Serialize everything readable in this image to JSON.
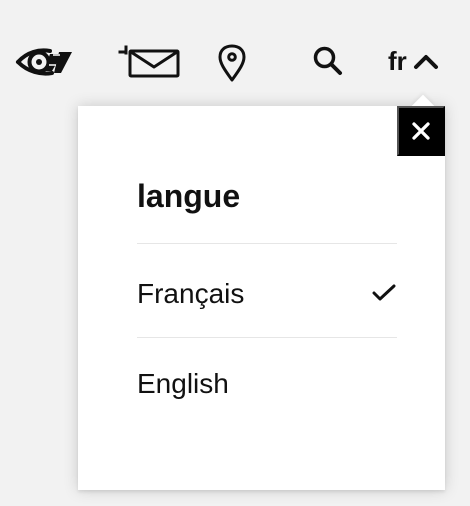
{
  "toolbar": {
    "icons": [
      {
        "name": "eye-icon"
      },
      {
        "name": "mail-icon"
      },
      {
        "name": "location-pin-icon"
      },
      {
        "name": "search-icon"
      }
    ],
    "language_toggle": {
      "current": "fr",
      "expanded": true
    }
  },
  "language_panel": {
    "title": "langue",
    "options": [
      {
        "label": "Français",
        "selected": true
      },
      {
        "label": "English",
        "selected": false
      }
    ],
    "close_icon": "close-icon",
    "colors": {
      "panel": "#ffffff",
      "close_background": "#000000",
      "close_icon": "#ffffff",
      "text": "#111111",
      "divider": "#e6e6e6"
    }
  }
}
